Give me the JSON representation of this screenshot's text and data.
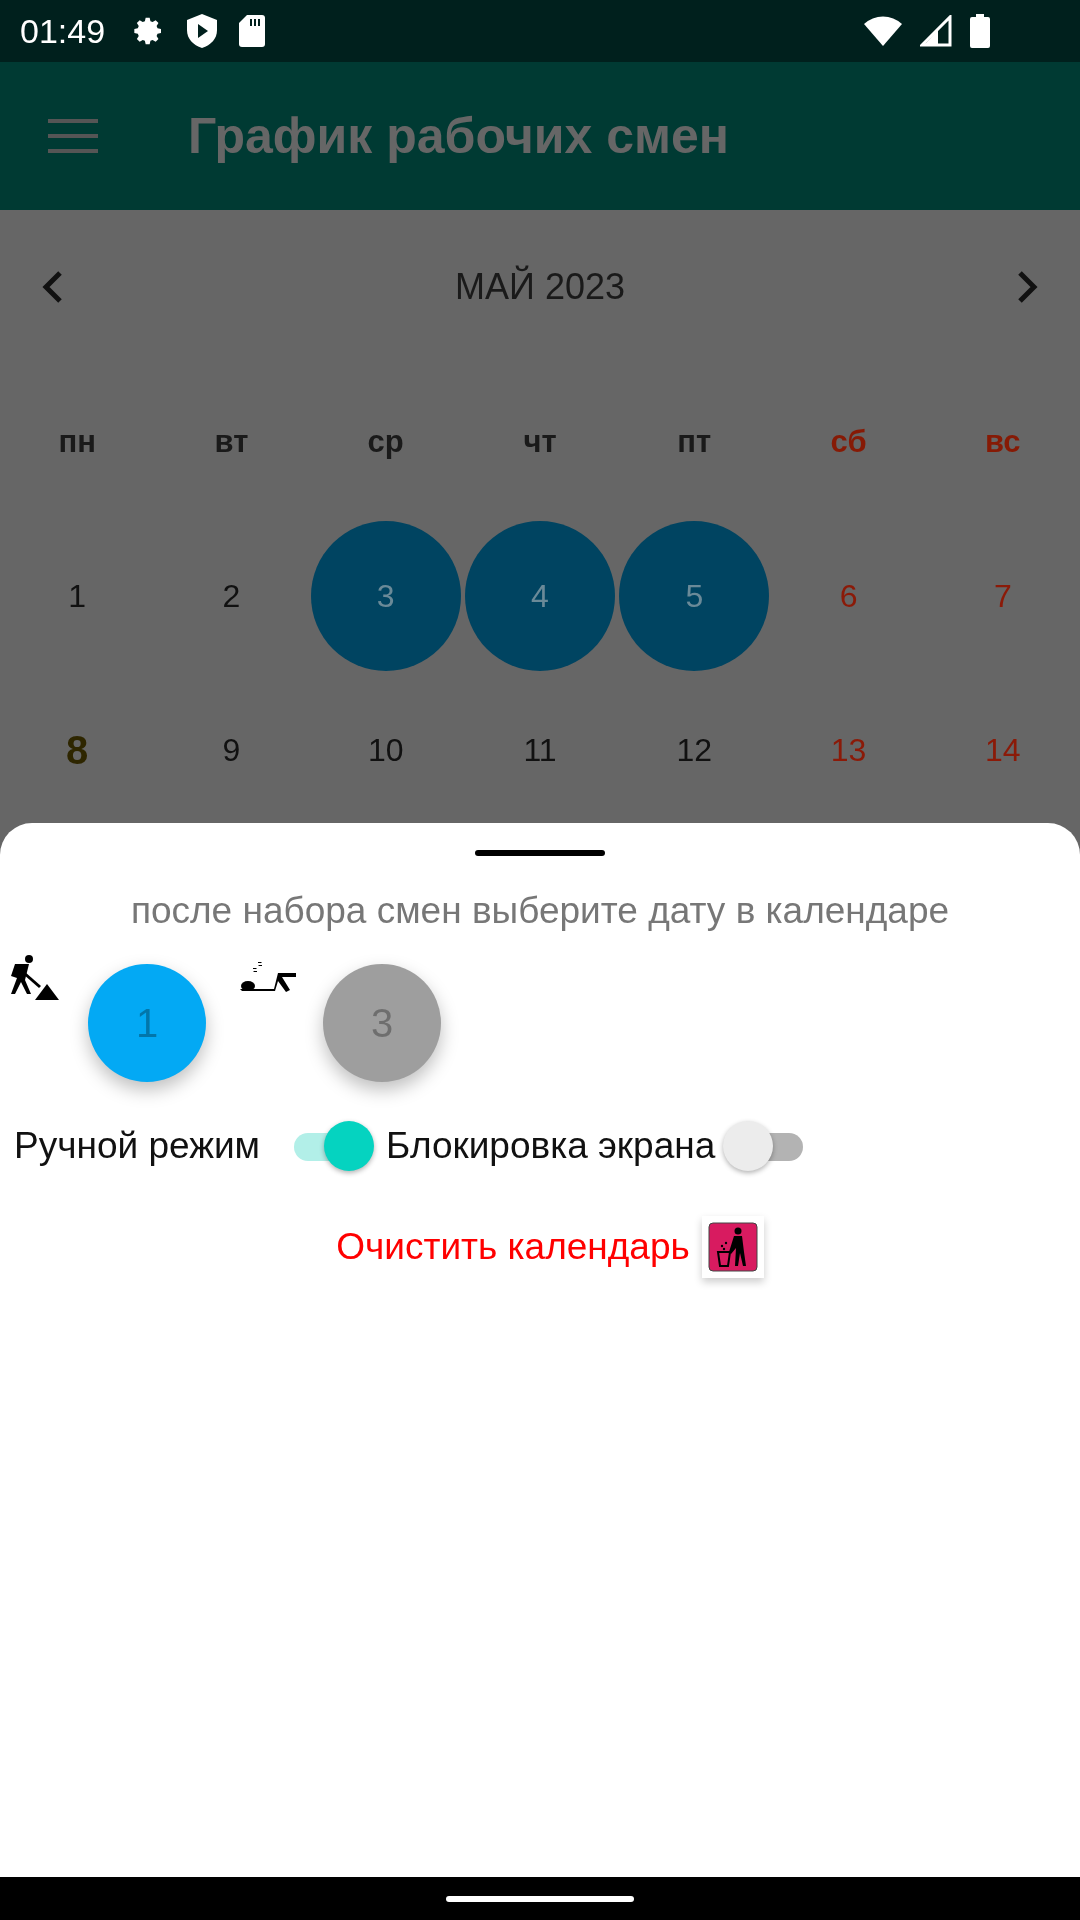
{
  "status_bar": {
    "time": "01:49"
  },
  "app_bar": {
    "title": "График рабочих смен"
  },
  "calendar": {
    "month_title": "МАЙ 2023",
    "weekdays": [
      {
        "label": "пн",
        "weekend": false
      },
      {
        "label": "вт",
        "weekend": false
      },
      {
        "label": "ср",
        "weekend": false
      },
      {
        "label": "чт",
        "weekend": false
      },
      {
        "label": "пт",
        "weekend": false
      },
      {
        "label": "сб",
        "weekend": true
      },
      {
        "label": "вс",
        "weekend": true
      }
    ],
    "weeks": [
      [
        {
          "day": "1",
          "selected": false,
          "weekend": false,
          "today": false
        },
        {
          "day": "2",
          "selected": false,
          "weekend": false,
          "today": false
        },
        {
          "day": "3",
          "selected": true,
          "weekend": false,
          "today": false
        },
        {
          "day": "4",
          "selected": true,
          "weekend": false,
          "today": false
        },
        {
          "day": "5",
          "selected": true,
          "weekend": false,
          "today": false
        },
        {
          "day": "6",
          "selected": false,
          "weekend": true,
          "today": false
        },
        {
          "day": "7",
          "selected": false,
          "weekend": true,
          "today": false
        }
      ],
      [
        {
          "day": "8",
          "selected": false,
          "weekend": false,
          "today": true
        },
        {
          "day": "9",
          "selected": false,
          "weekend": false,
          "today": false
        },
        {
          "day": "10",
          "selected": false,
          "weekend": false,
          "today": false
        },
        {
          "day": "11",
          "selected": false,
          "weekend": false,
          "today": false
        },
        {
          "day": "12",
          "selected": false,
          "weekend": false,
          "today": false
        },
        {
          "day": "13",
          "selected": false,
          "weekend": true,
          "today": false
        },
        {
          "day": "14",
          "selected": false,
          "weekend": true,
          "today": false
        }
      ]
    ]
  },
  "sheet": {
    "hint": "после набора смен выберите дату в календаре",
    "shifts": [
      {
        "kind": "work",
        "label": "1",
        "color": "#03a9f4"
      },
      {
        "kind": "rest",
        "label": "3",
        "color": "#9e9e9e"
      }
    ],
    "switches": [
      {
        "label": "Ручной режим",
        "on": true
      },
      {
        "label": "Блокировка экрана",
        "on": false
      }
    ],
    "clear_button": {
      "label": "Очистить календарь"
    }
  }
}
